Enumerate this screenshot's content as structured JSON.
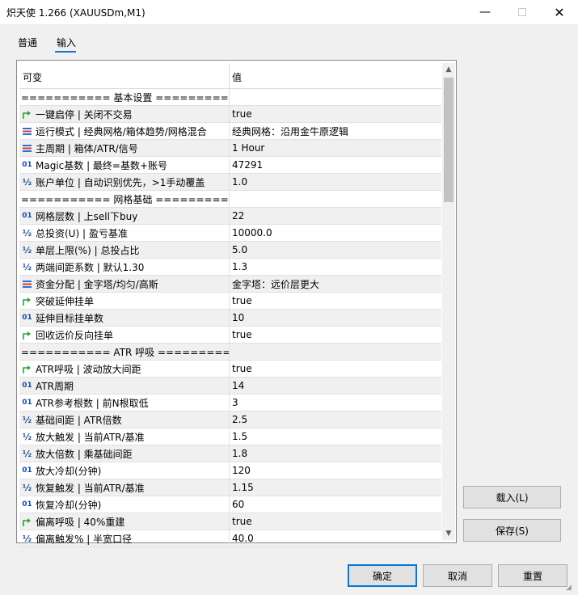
{
  "window": {
    "title": "炽天使 1.266 (XAUUSDm,M1)",
    "minimize": "—",
    "close": "✕"
  },
  "tabs": [
    "普通",
    "输入"
  ],
  "table": {
    "col_variable": "可变",
    "col_value": "值",
    "rows": [
      {
        "icon": "none",
        "name": "=========== 基本设置 ===========",
        "value": ""
      },
      {
        "icon": "arrow",
        "name": "一键启停 | 关闭不交易",
        "value": "true"
      },
      {
        "icon": "enum",
        "name": "运行模式 | 经典网格/箱体趋势/网格混合",
        "value": "经典网格：沿用金牛原逻辑"
      },
      {
        "icon": "enum",
        "name": "主周期 | 箱体/ATR/信号",
        "value": "1 Hour"
      },
      {
        "icon": "int",
        "name": "Magic基数 | 最终=基数+账号",
        "value": "47291"
      },
      {
        "icon": "half",
        "name": "账户单位 | 自动识别优先，>1手动覆盖",
        "value": "1.0"
      },
      {
        "icon": "none",
        "name": "=========== 网格基础 ===========",
        "value": ""
      },
      {
        "icon": "int",
        "name": "网格层数 | 上sell下buy",
        "value": "22"
      },
      {
        "icon": "half",
        "name": "总投资(U) | 盈亏基准",
        "value": "10000.0"
      },
      {
        "icon": "half",
        "name": "单层上限(%) | 总投占比",
        "value": "5.0"
      },
      {
        "icon": "half",
        "name": "两端间距系数 | 默认1.30",
        "value": "1.3"
      },
      {
        "icon": "enum",
        "name": "资金分配 | 金字塔/均匀/高斯",
        "value": "金字塔：远价层更大"
      },
      {
        "icon": "arrow",
        "name": "突破延伸挂单",
        "value": "true"
      },
      {
        "icon": "int",
        "name": "延伸目标挂单数",
        "value": "10"
      },
      {
        "icon": "arrow",
        "name": "回收远价反向挂单",
        "value": "true"
      },
      {
        "icon": "none",
        "name": "=========== ATR 呼吸 ===========",
        "value": ""
      },
      {
        "icon": "arrow",
        "name": "ATR呼吸 | 波动放大间距",
        "value": "true"
      },
      {
        "icon": "int",
        "name": "ATR周期",
        "value": "14"
      },
      {
        "icon": "int",
        "name": "ATR参考根数 | 前N根取低",
        "value": "3"
      },
      {
        "icon": "half",
        "name": "基础间距 | ATR倍数",
        "value": "2.5"
      },
      {
        "icon": "half",
        "name": "放大触发 | 当前ATR/基准",
        "value": "1.5"
      },
      {
        "icon": "half",
        "name": "放大倍数 | 乘基础间距",
        "value": "1.8"
      },
      {
        "icon": "int",
        "name": "放大冷却(分钟)",
        "value": "120"
      },
      {
        "icon": "half",
        "name": "恢复触发 | 当前ATR/基准",
        "value": "1.15"
      },
      {
        "icon": "int",
        "name": "恢复冷却(分钟)",
        "value": "60"
      },
      {
        "icon": "arrow",
        "name": "偏离呼吸 | 40%重建",
        "value": "true"
      },
      {
        "icon": "half",
        "name": "偏离触发% | 半宽口径",
        "value": "40.0"
      }
    ]
  },
  "icon_glyphs": {
    "int": "01",
    "half": "½"
  },
  "buttons": {
    "load": "载入(L)",
    "save": "保存(S)",
    "ok": "确定",
    "cancel": "取消",
    "reset": "重置"
  },
  "colors": {
    "accent": "#0078d7",
    "arrow_icon": "#2e9e3a",
    "int_icon": "#1f4fa0"
  }
}
